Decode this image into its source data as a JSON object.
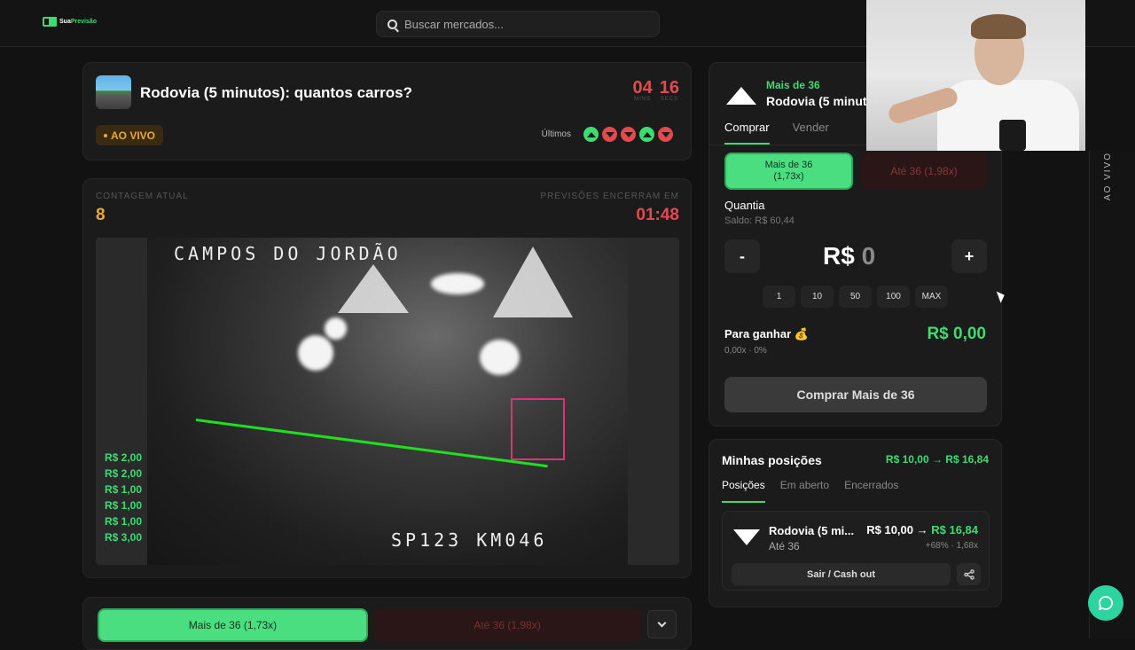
{
  "header": {
    "logo": {
      "prefix": "Sua",
      "suffix": "Previsão"
    },
    "search_placeholder": "Buscar mercados..."
  },
  "market": {
    "title": "Rodovia (5 minutos): quantos carros?",
    "timer": {
      "mins": "04",
      "mins_label": "MINS",
      "secs": "16",
      "secs_label": "SECS"
    },
    "live_label": "AO VIVO",
    "last_label": "Últimos",
    "last_results": [
      "up",
      "down",
      "down",
      "up",
      "down"
    ]
  },
  "stream": {
    "count_label": "CONTAGEM ATUAL",
    "count_value": "8",
    "end_label": "PREVISÕES ENCERRAM EM",
    "end_value": "01:48",
    "camera_caption": "CAMPOS DO JORDÃO",
    "camera_km": "SP123  KM046",
    "recent_bets": [
      "R$ 2,00",
      "R$ 2,00",
      "R$ 1,00",
      "R$ 1,00",
      "R$ 1,00",
      "R$ 3,00"
    ]
  },
  "bottom_bar": {
    "yes_label": "Mais de 36 (1,73x)",
    "no_label": "Até 36 (1,98x)"
  },
  "trade": {
    "outcome": "Mais de 36",
    "market_short": "Rodovia (5 minutos): quantos carros?",
    "tabs": [
      "Comprar",
      "Vender"
    ],
    "yes_line1": "Mais de 36",
    "yes_line2": "(1,73x)",
    "no_label": "Até 36 (1,98x)",
    "quantity_label": "Quantia",
    "balance": "Saldo: R$ 60,44",
    "minus": "-",
    "plus": "+",
    "amount_prefix": "R$",
    "amount_value": "0",
    "quick_amounts": [
      "1",
      "10",
      "50",
      "100",
      "MAX"
    ],
    "gain_label": "Para ganhar 💰",
    "gain_sub": "0,00x · 0%",
    "gain_value": "R$ 0,00",
    "buy_label": "Comprar Mais de 36"
  },
  "side": {
    "vertical_label": "AO VIVO"
  },
  "positions": {
    "title": "Minhas posições",
    "summary": "R$ 10,00 → R$ 16,84",
    "tabs": [
      "Posições",
      "Em aberto",
      "Encerrados"
    ],
    "item": {
      "name": "Rodovia (5 mi...",
      "side": "Até 36",
      "cost": "R$ 10,00 →",
      "value": "R$ 16,84",
      "pct": "+68% · 1,68x",
      "cashout_label": "Sair / Cash out"
    }
  },
  "colors": {
    "green": "#3ddc72",
    "red": "#e5484d",
    "amber": "#e8a93a",
    "bg": "#121212"
  }
}
